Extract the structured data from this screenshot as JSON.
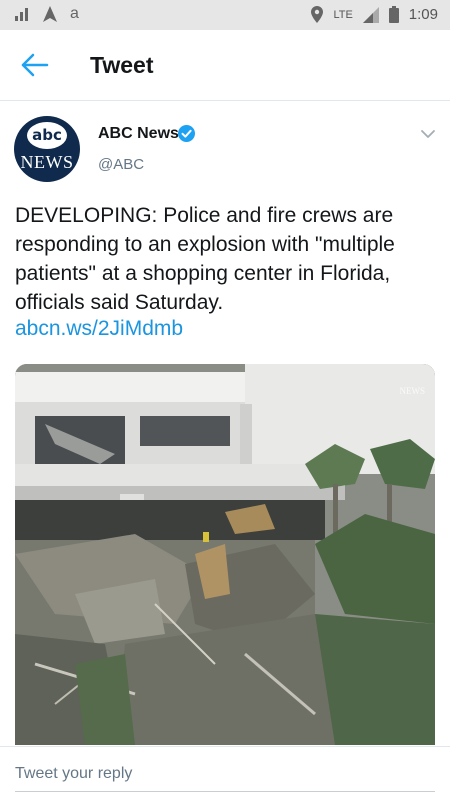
{
  "status_bar": {
    "left_icons": [
      "signal-bars-icon",
      "navigation-arrow-icon",
      "amazon-icon"
    ],
    "amazon_glyph": "a",
    "location_icon": "location-pin-icon",
    "network": "LTE",
    "time": "1:09"
  },
  "header": {
    "back_icon": "arrow-left-icon",
    "title": "Tweet"
  },
  "tweet": {
    "author": {
      "name": "ABC News",
      "handle": "@ABC",
      "verified": true,
      "avatar_top": "abc",
      "avatar_bottom": "NEWS"
    },
    "text": "DEVELOPING: Police and fire crews are responding to an explosion with \"multiple patients\" at a shopping center in Florida, officials said Saturday.",
    "link": "abcn.ws/2JiMdmb",
    "media": {
      "type": "video-thumbnail",
      "watermark": "NEWS"
    }
  },
  "reply": {
    "placeholder": "Tweet your reply"
  },
  "colors": {
    "accent": "#1da1f2",
    "link": "#1b95e0",
    "text_primary": "#14171a",
    "text_secondary": "#657786",
    "status_bar_bg": "#e6e6e6"
  }
}
